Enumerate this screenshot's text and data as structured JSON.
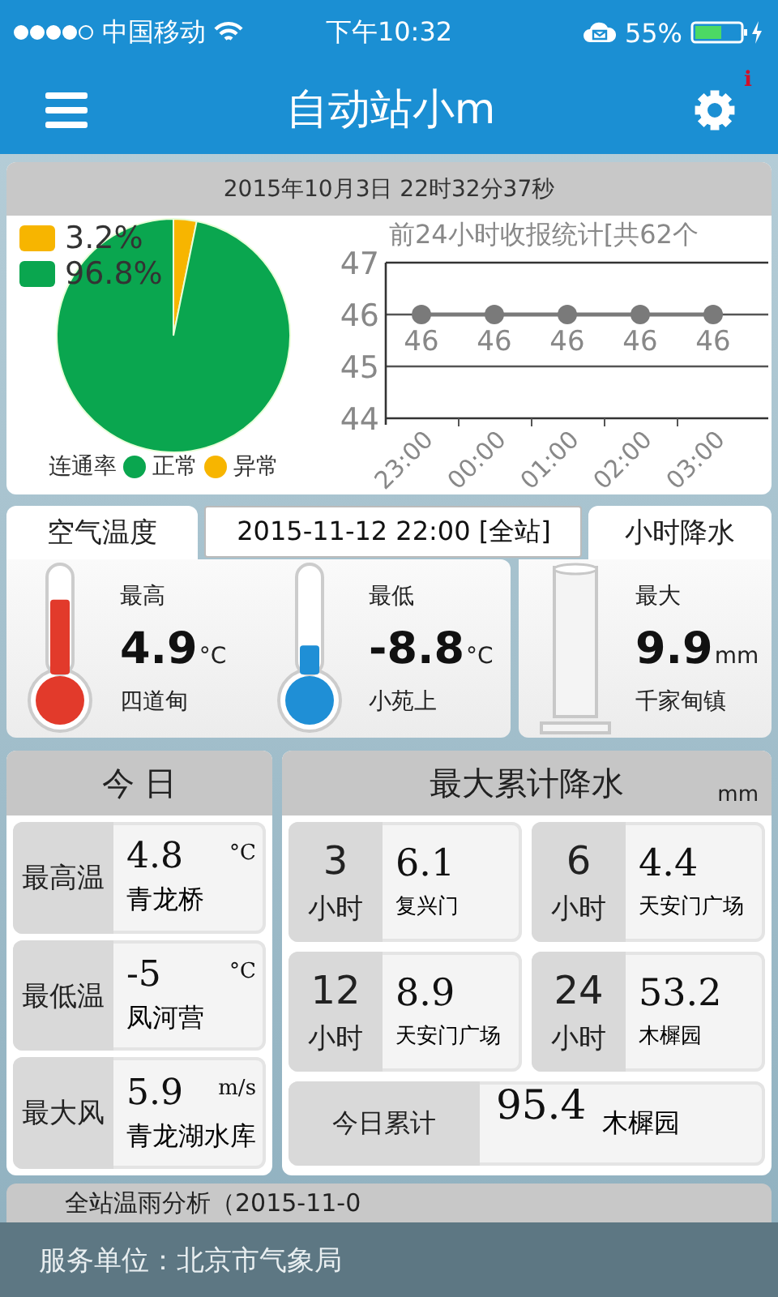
{
  "status_bar": {
    "carrier": "中国移动",
    "time": "下午10:32",
    "battery": "55%"
  },
  "nav": {
    "title": "自动站小m",
    "badge": "i"
  },
  "summary": {
    "timestamp": "2015年10月3日 22时32分37秒",
    "connectivity": {
      "chart_data": {
        "type": "pie",
        "title": "连通率",
        "categories": [
          "异常",
          "正常"
        ],
        "series": [
          {
            "values": [
              3.2,
              96.8
            ]
          }
        ],
        "legend": "bottom"
      },
      "slices": [
        {
          "color": "#f7b500",
          "value_label": "3.2%"
        },
        {
          "color": "#0aa64f",
          "value_label": "96.8%"
        }
      ]
    },
    "reports": {
      "chart_data": {
        "type": "line",
        "title": "前24小时收报统计[共62个",
        "categories": [
          "23:00",
          "00:00",
          "01:00",
          "02:00",
          "03:00"
        ],
        "series": [
          {
            "color": "#7a7a7a",
            "marker": "circle",
            "values": [
              46,
              46,
              46,
              46,
              46
            ]
          }
        ],
        "ylim": [
          44,
          47
        ],
        "yticks": [
          44,
          45,
          46,
          47
        ],
        "data_labels": true
      }
    }
  },
  "observation_time": "2015-11-12 22:00 [全站]",
  "air_temperature": {
    "title": "空气温度",
    "items": [
      {
        "kind": "warm",
        "label": "最高",
        "value": "4.9",
        "unit": "°C",
        "station": "四道甸",
        "level": 0.72
      },
      {
        "kind": "cold",
        "label": "最低",
        "value": "-8.8",
        "unit": "°C",
        "station": "小苑上",
        "level": 0.28
      }
    ]
  },
  "hourly_rain": {
    "title": "小时降水",
    "label": "最大",
    "value": "9.9",
    "unit": "mm",
    "station": "千家甸镇"
  },
  "today": {
    "title": "今 日",
    "rows": [
      {
        "label": "最高温",
        "value": "4.8",
        "unit": "°C",
        "station": "青龙桥"
      },
      {
        "label": "最低温",
        "value": "-5",
        "unit": "°C",
        "station": "凤河营"
      },
      {
        "label": "最大风",
        "value": "5.9",
        "unit": "m/s",
        "station": "青龙湖水库"
      }
    ]
  },
  "max_rain": {
    "title": "最大累计降水",
    "unit": "mm",
    "cells": [
      {
        "hours": "3",
        "hours_unit": "小时",
        "value": "6.1",
        "station": "复兴门"
      },
      {
        "hours": "6",
        "hours_unit": "小时",
        "value": "4.4",
        "station": "天安门广场"
      },
      {
        "hours": "12",
        "hours_unit": "小时",
        "value": "8.9",
        "station": "天安门广场"
      },
      {
        "hours": "24",
        "hours_unit": "小时",
        "value": "53.2",
        "station": "木樨园"
      }
    ],
    "total": {
      "label": "今日累计",
      "value": "95.4",
      "station": "木樨园"
    }
  },
  "analysis_title": "全站温雨分析（2015-11-0",
  "footer": "服务单位：北京市气象局"
}
